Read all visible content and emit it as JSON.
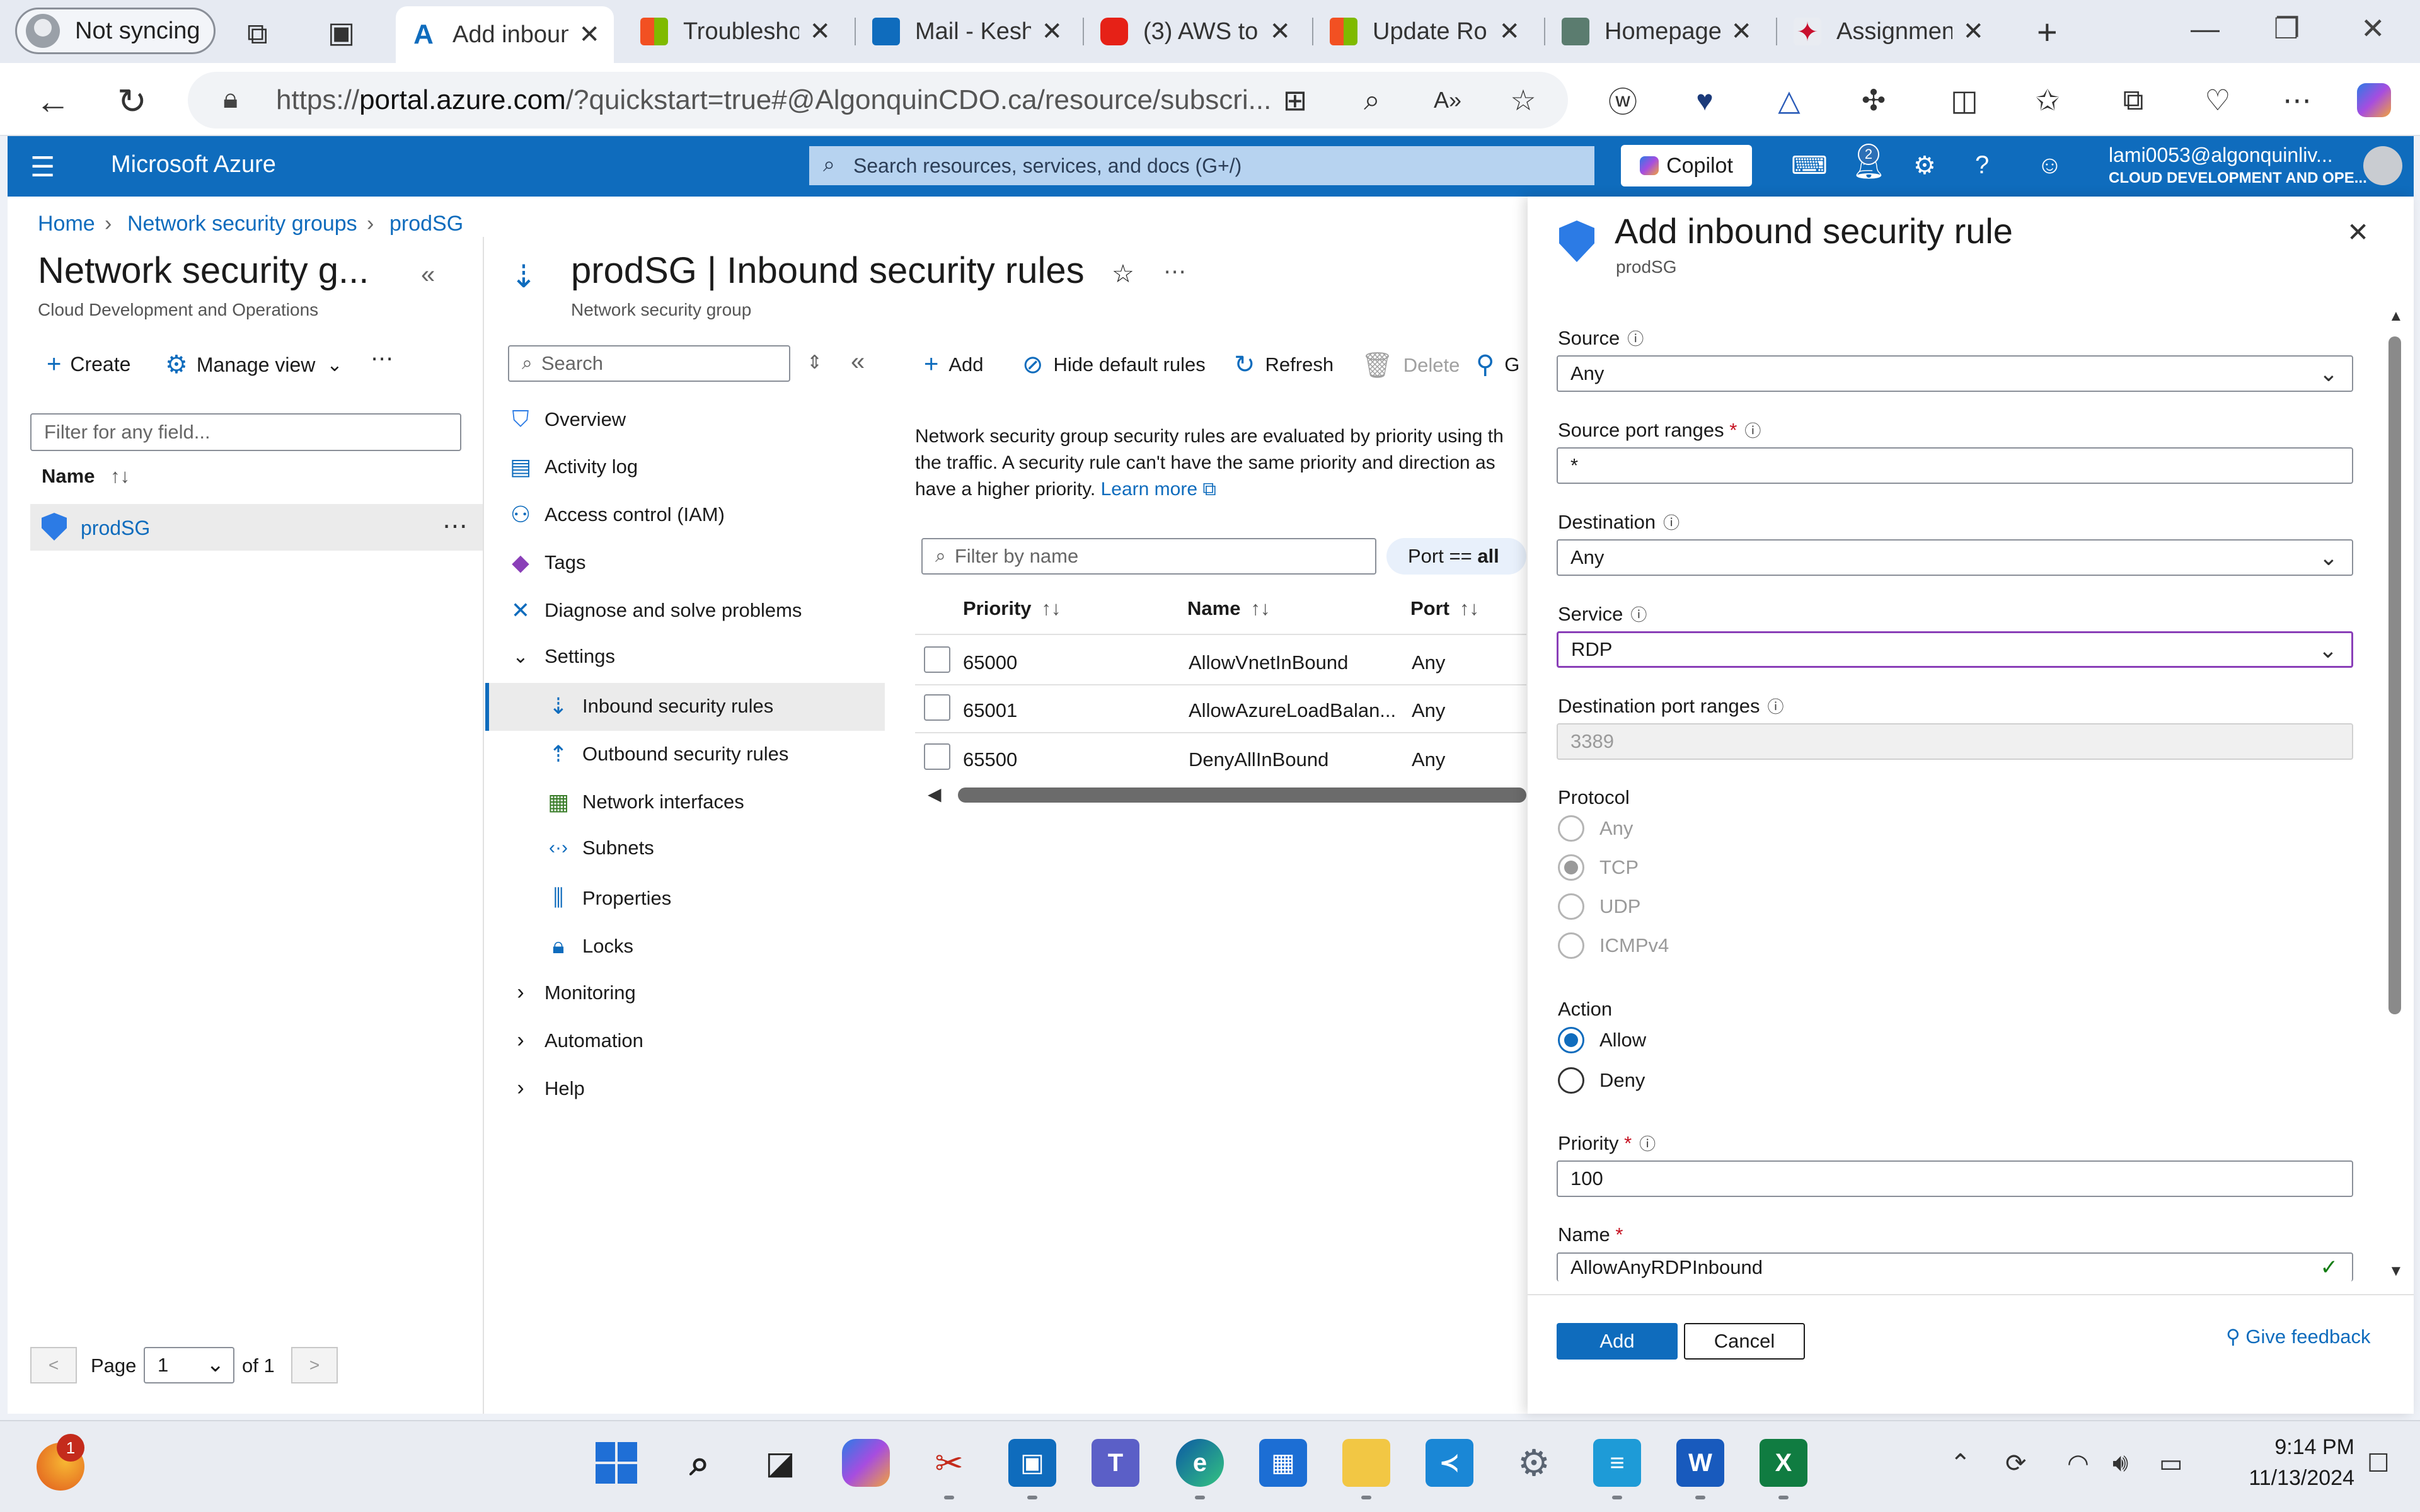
{
  "browser": {
    "profile_label": "Not syncing",
    "tabs": [
      {
        "title": "Add inbound security rule",
        "active": true
      },
      {
        "title": "Troubleshoot"
      },
      {
        "title": "Mail - Kesh"
      },
      {
        "title": "(3) AWS to"
      },
      {
        "title": "Update Roll"
      },
      {
        "title": "Homepage"
      },
      {
        "title": "Assignment"
      }
    ],
    "url_prefix": "https://",
    "url_host": "portal.azure.com",
    "url_rest": "/?quickstart=true#@AlgonquinCDO.ca/resource/subscri..."
  },
  "azure_header": {
    "brand": "Microsoft Azure",
    "search_placeholder": "Search resources, services, and docs (G+/)",
    "copilot_label": "Copilot",
    "notification_count": "2",
    "user_email": "lami0053@algonquinliv...",
    "user_org": "CLOUD DEVELOPMENT AND OPE..."
  },
  "breadcrumb": [
    "Home",
    "Network security groups",
    "prodSG"
  ],
  "left_blade": {
    "title": "Network security g...",
    "subtitle": "Cloud Development and Operations",
    "create_label": "Create",
    "manage_view_label": "Manage view",
    "filter_placeholder": "Filter for any field...",
    "column_name": "Name",
    "items": [
      "prodSG"
    ],
    "page_label": "Page",
    "page_value": "1",
    "page_of": "of 1"
  },
  "resource_blade": {
    "title": "prodSG | Inbound security rules",
    "subtitle": "Network security group",
    "search_placeholder": "Search",
    "menu": [
      {
        "label": "Overview",
        "icon": "shield-icon"
      },
      {
        "label": "Activity log",
        "icon": "activity-log-icon"
      },
      {
        "label": "Access control (IAM)",
        "icon": "iam-icon"
      },
      {
        "label": "Tags",
        "icon": "tag-icon"
      },
      {
        "label": "Diagnose and solve problems",
        "icon": "wrench-icon"
      },
      {
        "label": "Settings",
        "icon": "chevron-down-icon"
      },
      {
        "label": "Inbound security rules",
        "icon": "inbound-icon"
      },
      {
        "label": "Outbound security rules",
        "icon": "outbound-icon"
      },
      {
        "label": "Network interfaces",
        "icon": "nic-icon"
      },
      {
        "label": "Subnets",
        "icon": "subnet-icon"
      },
      {
        "label": "Properties",
        "icon": "properties-icon"
      },
      {
        "label": "Locks",
        "icon": "lock-icon"
      },
      {
        "label": "Monitoring",
        "icon": "chevron-right-icon"
      },
      {
        "label": "Automation",
        "icon": "chevron-right-icon"
      },
      {
        "label": "Help",
        "icon": "chevron-right-icon"
      }
    ],
    "commands": {
      "add": "Add",
      "hide_default": "Hide default rules",
      "refresh": "Refresh",
      "delete": "Delete",
      "more": "G"
    },
    "description_line1": "Network security group security rules are evaluated by priority using th",
    "description_line2": "the traffic. A security rule can't have the same priority and direction as",
    "description_line3": "have a higher priority.",
    "learn_more": "Learn more",
    "filter_placeholder": "Filter by name",
    "port_filter_label": "Port ==",
    "port_filter_value": "all",
    "columns": [
      "Priority",
      "Name",
      "Port"
    ],
    "rows": [
      {
        "priority": "65000",
        "name": "AllowVnetInBound",
        "port": "Any"
      },
      {
        "priority": "65001",
        "name": "AllowAzureLoadBalan...",
        "port": "Any"
      },
      {
        "priority": "65500",
        "name": "DenyAllInBound",
        "port": "Any"
      }
    ]
  },
  "panel": {
    "title": "Add inbound security rule",
    "subtitle": "prodSG",
    "source_label": "Source",
    "source_value": "Any",
    "source_port_label": "Source port ranges",
    "source_port_value": "*",
    "destination_label": "Destination",
    "destination_value": "Any",
    "service_label": "Service",
    "service_value": "RDP",
    "dest_port_label": "Destination port ranges",
    "dest_port_value": "3389",
    "protocol_label": "Protocol",
    "protocols": [
      "Any",
      "TCP",
      "UDP",
      "ICMPv4"
    ],
    "protocol_selected": "TCP",
    "action_label": "Action",
    "actions": [
      "Allow",
      "Deny"
    ],
    "action_selected": "Allow",
    "priority_label": "Priority",
    "priority_value": "100",
    "name_label": "Name",
    "name_value": "AllowAnyRDPInbound",
    "add_button": "Add",
    "cancel_button": "Cancel",
    "feedback_link": "Give feedback"
  },
  "taskbar": {
    "weather_badge": "1",
    "time": "9:14 PM",
    "date": "11/13/2024"
  },
  "colors": {
    "azure_blue": "#0f6cbd",
    "focus_purple": "#8a3fb8",
    "required_red": "#c50f1f"
  }
}
